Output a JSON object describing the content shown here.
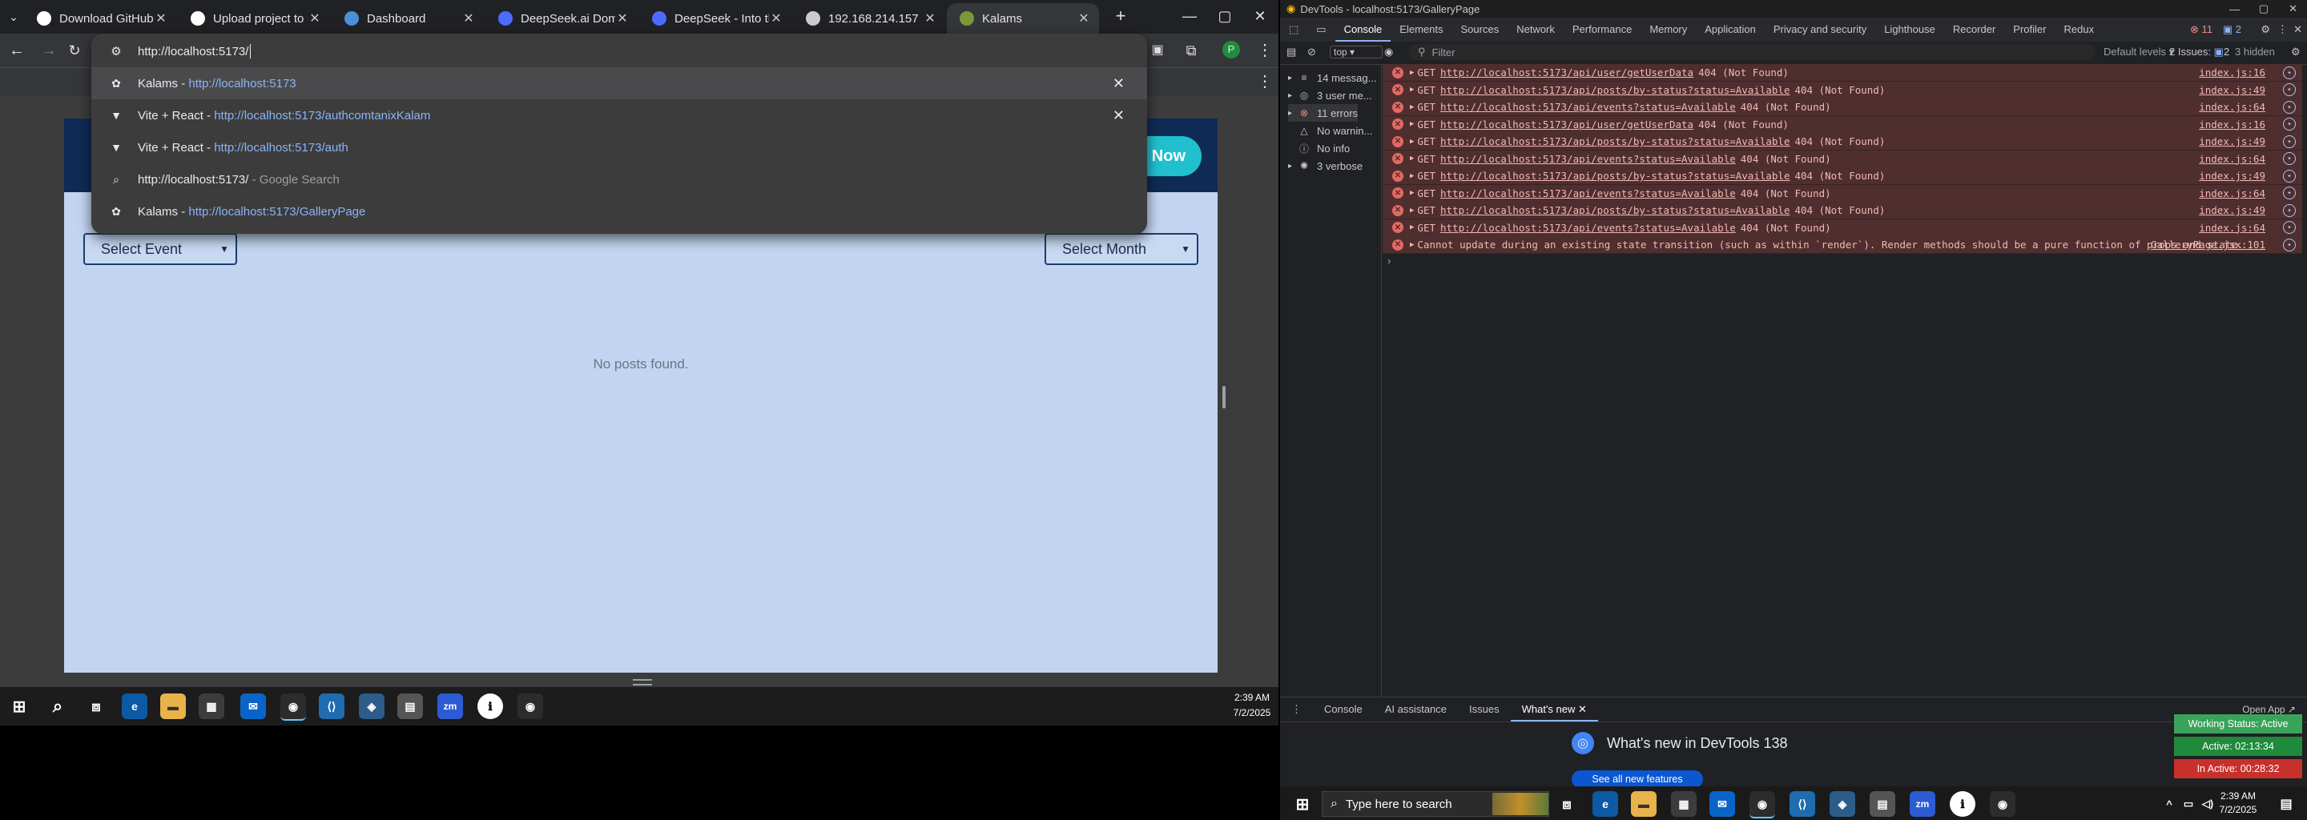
{
  "browser": {
    "tabs": [
      {
        "title": "Download GitHub Des",
        "favicon": "github-icon",
        "active": false
      },
      {
        "title": "Upload project to kala",
        "favicon": "openai-icon",
        "active": false
      },
      {
        "title": "Dashboard",
        "favicon": "dashboard-icon",
        "active": false
      },
      {
        "title": "DeepSeek.ai Domain F",
        "favicon": "deepseek-icon",
        "active": false
      },
      {
        "title": "DeepSeek - Into the U",
        "favicon": "deepseek-icon",
        "active": false
      },
      {
        "title": "192.168.214.157",
        "favicon": "vite-icon",
        "active": false
      },
      {
        "title": "Kalams",
        "favicon": "kalams-icon",
        "active": true
      }
    ],
    "new_tab": "+",
    "window_controls": {
      "minimize": "—",
      "maximize": "▢",
      "close": "✕"
    },
    "omnibox": {
      "value": "http://localhost:5173/",
      "suggestions": [
        {
          "title": "Kalams",
          "sep": " - ",
          "url": "http://localhost:5173",
          "extra": "",
          "icon": "kalams-icon",
          "removable": true,
          "highlighted": true
        },
        {
          "title": "Vite + React",
          "sep": " - ",
          "url": "http://localhost:5173/",
          "extra": "authcomtanixKalam",
          "icon": "vite-icon",
          "removable": true,
          "highlighted": false
        },
        {
          "title": "Vite + React",
          "sep": " - ",
          "url": "http://localhost:5173/",
          "extra": "auth",
          "icon": "vite-icon",
          "removable": false,
          "highlighted": false
        },
        {
          "title": "http://localhost:5173/",
          "sep": " - ",
          "url": "",
          "extra": "Google Search",
          "icon": "search-icon",
          "removable": false,
          "highlighted": false
        },
        {
          "title": "Kalams",
          "sep": " - ",
          "url": "http://localhost:5173/",
          "extra": "GalleryPage",
          "icon": "kalams-icon",
          "removable": false,
          "highlighted": false
        }
      ]
    },
    "page": {
      "cta_label": "t Now",
      "select_event": "Select Event",
      "select_month": "Select Month",
      "empty_message": "No posts found."
    }
  },
  "taskbar_left": {
    "time": "2:39 AM",
    "date": "7/2/2025"
  },
  "devtools": {
    "title": "DevTools - localhost:5173/GalleryPage",
    "tabs": [
      "Console",
      "Elements",
      "Sources",
      "Network",
      "Performance",
      "Memory",
      "Application",
      "Privacy and security",
      "Lighthouse",
      "Recorder",
      "Profiler",
      "Redux"
    ],
    "active_tab": "Console",
    "error_count": "11",
    "issue_count": "2",
    "context": "top",
    "filter_placeholder": "Filter",
    "levels": "Default levels",
    "issues_label": "2 Issues:",
    "issues_count": "2",
    "hidden_label": "3 hidden",
    "sidebar": [
      {
        "label": "14 messag...",
        "icon": "list-icon"
      },
      {
        "label": "3 user me...",
        "icon": "user-icon"
      },
      {
        "label": "11 errors",
        "icon": "error-icon"
      },
      {
        "label": "No warnin...",
        "icon": "warning-icon"
      },
      {
        "label": "No info",
        "icon": "info-icon"
      },
      {
        "label": "3 verbose",
        "icon": "bug-icon"
      }
    ],
    "console_rows": [
      {
        "method": "GET",
        "url": "http://localhost:5173/api/user/getUserData",
        "status": "404 (Not Found)",
        "source": "index.js:16"
      },
      {
        "method": "GET",
        "url": "http://localhost:5173/api/posts/by-status?status=Available",
        "status": "404 (Not Found)",
        "source": "index.js:49"
      },
      {
        "method": "GET",
        "url": "http://localhost:5173/api/events?status=Available",
        "status": "404 (Not Found)",
        "source": "index.js:64"
      },
      {
        "method": "GET",
        "url": "http://localhost:5173/api/user/getUserData",
        "status": "404 (Not Found)",
        "source": "index.js:16"
      },
      {
        "method": "GET",
        "url": "http://localhost:5173/api/posts/by-status?status=Available",
        "status": "404 (Not Found)",
        "source": "index.js:49"
      },
      {
        "method": "GET",
        "url": "http://localhost:5173/api/events?status=Available",
        "status": "404 (Not Found)",
        "source": "index.js:64"
      },
      {
        "method": "GET",
        "url": "http://localhost:5173/api/posts/by-status?status=Available",
        "status": "404 (Not Found)",
        "source": "index.js:49"
      },
      {
        "method": "GET",
        "url": "http://localhost:5173/api/events?status=Available",
        "status": "404 (Not Found)",
        "source": "index.js:64"
      },
      {
        "method": "GET",
        "url": "http://localhost:5173/api/posts/by-status?status=Available",
        "status": "404 (Not Found)",
        "source": "index.js:49"
      },
      {
        "method": "GET",
        "url": "http://localhost:5173/api/events?status=Available",
        "status": "404 (Not Found)",
        "source": "index.js:64"
      },
      {
        "method": "",
        "url": "",
        "status": "Cannot update during an existing state transition (such as within `render`). Render methods should be a pure function of props and state.",
        "source": "GalleryPage.jsx:101"
      }
    ],
    "drawer_tabs": [
      "Console",
      "AI assistance",
      "Issues",
      "What's new"
    ],
    "drawer_active": "What's new",
    "whats_new_title": "What's new in DevTools 138",
    "see_all": "See all new features",
    "open_app": "Open App ↗"
  },
  "status_widgets": [
    {
      "label": "Working Status: Active",
      "color": "#3aa35a"
    },
    {
      "label": "Active: 02:13:34",
      "color": "#1f8a3c"
    },
    {
      "label": "In Active: 00:28:32",
      "color": "#c8302c"
    }
  ],
  "taskbar_right": {
    "search_placeholder": "Type here to search",
    "time": "2:39 AM",
    "date": "7/2/2025"
  }
}
